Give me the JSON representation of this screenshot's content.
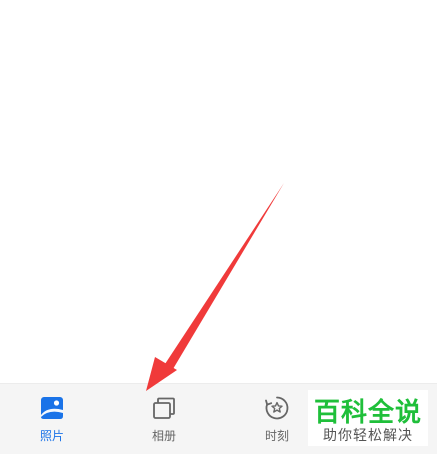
{
  "tab_bar": {
    "tabs": [
      {
        "label": "照片",
        "icon": "photo-icon",
        "active": true
      },
      {
        "label": "相册",
        "icon": "album-icon",
        "active": false
      },
      {
        "label": "时刻",
        "icon": "moments-icon",
        "active": false
      }
    ]
  },
  "watermark": {
    "title": "百科全说",
    "subtitle": "助你轻松解决"
  },
  "colors": {
    "active": "#1a73e8",
    "inactive": "#666666",
    "tab_bar_bg": "#f5f5f5",
    "arrow": "#f03a3a",
    "watermark_green": "#1fbf3a"
  }
}
